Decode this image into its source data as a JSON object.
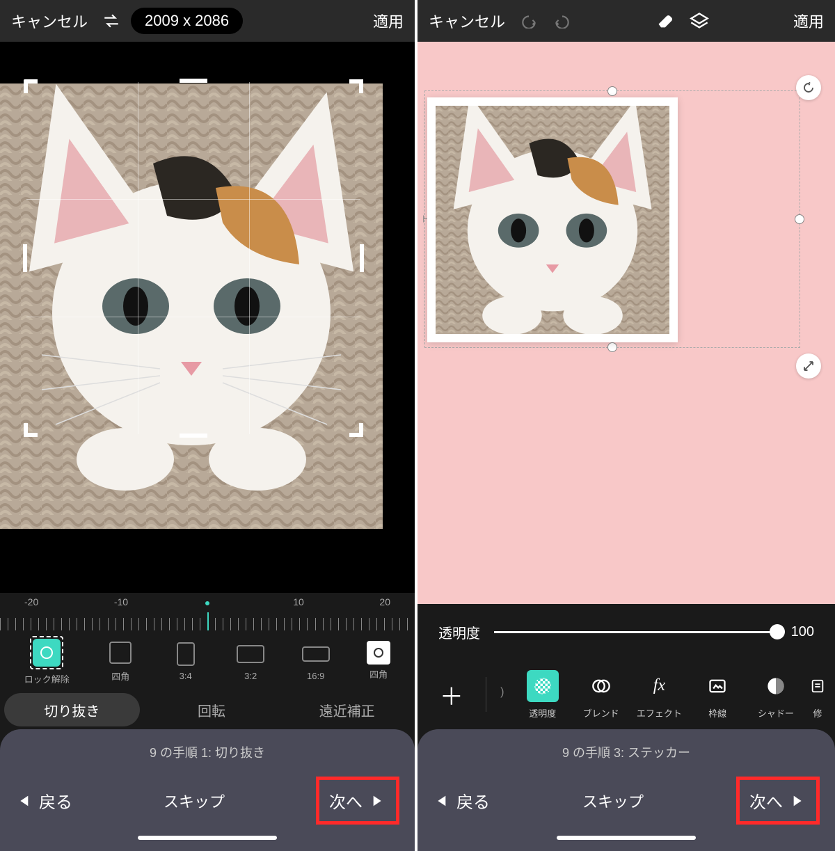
{
  "left": {
    "topbar": {
      "cancel": "キャンセル",
      "apply": "適用",
      "dimensions": "2009 x 2086"
    },
    "ruler": {
      "labels": [
        "-20",
        "-10",
        "10",
        "20"
      ]
    },
    "aspectRatios": [
      {
        "label": "ロック解除",
        "key": "unlock"
      },
      {
        "label": "四角",
        "key": "square"
      },
      {
        "label": "3:4",
        "key": "3-4"
      },
      {
        "label": "3:2",
        "key": "3-2"
      },
      {
        "label": "16:9",
        "key": "16-9"
      },
      {
        "label": "四角",
        "key": "instagram"
      }
    ],
    "tabs": {
      "crop": "切り抜き",
      "rotate": "回転",
      "perspective": "遠近補正"
    },
    "steps": {
      "label": "9 の手順 1:  切り抜き"
    },
    "nav": {
      "back": "戻る",
      "skip": "スキップ",
      "next": "次へ"
    }
  },
  "right": {
    "topbar": {
      "cancel": "キャンセル",
      "apply": "適用"
    },
    "opacity": {
      "label": "透明度",
      "value": "100"
    },
    "tools": [
      {
        "label": "",
        "key": "add",
        "icon": "+"
      },
      {
        "label": "",
        "key": "prev",
        "icon": "›"
      },
      {
        "label": "透明度",
        "key": "opacity"
      },
      {
        "label": "ブレンド",
        "key": "blend"
      },
      {
        "label": "エフェクト",
        "key": "effects"
      },
      {
        "label": "枠線",
        "key": "border"
      },
      {
        "label": "シャドー",
        "key": "shadow"
      },
      {
        "label": "修",
        "key": "fix"
      }
    ],
    "steps": {
      "label": "9 の手順 3:  ステッカー"
    },
    "nav": {
      "back": "戻る",
      "skip": "スキップ",
      "next": "次へ"
    }
  }
}
